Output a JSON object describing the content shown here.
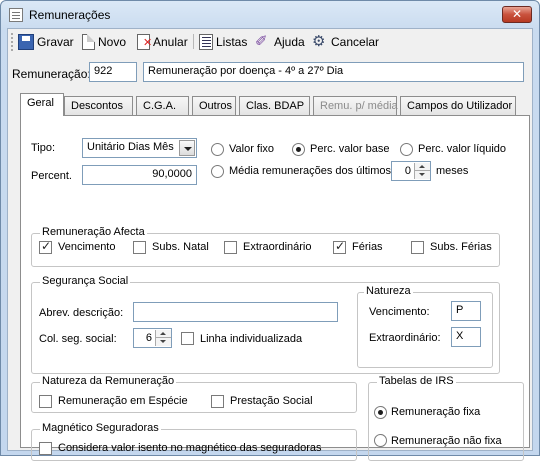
{
  "window": {
    "title": "Remunerações"
  },
  "toolbar": {
    "save": "Gravar",
    "new": "Novo",
    "cancel_record": "Anular",
    "lists": "Listas",
    "help": "Ajuda",
    "cancel": "Cancelar"
  },
  "header": {
    "remuneracao_label": "Remuneração:",
    "code": "922",
    "description": "Remuneração por doença - 4º a 27º Dia"
  },
  "tabs": [
    "Geral",
    "Descontos",
    "C.G.A.",
    "Outros",
    "Clas. BDAP",
    "Remu. p/ média",
    "Campos do Utilizador"
  ],
  "geral": {
    "tipo_label": "Tipo:",
    "tipo_value": "Unitário Dias Mês",
    "percent_label": "Percent.",
    "percent_value": "90,0000",
    "radio_valor_fixo": "Valor fixo",
    "radio_perc_base": "Perc. valor base",
    "radio_perc_liquido": "Perc. valor líquido",
    "radio_media": "Média remunerações dos últimos",
    "media_months": "0",
    "meses_label": "meses"
  },
  "remuneracao_afecta": {
    "title": "Remuneração Afecta",
    "items": [
      {
        "label": "Vencimento",
        "checked": true
      },
      {
        "label": "Subs. Natal",
        "checked": false
      },
      {
        "label": "Extraordinário",
        "checked": false
      },
      {
        "label": "Férias",
        "checked": true
      },
      {
        "label": "Subs. Férias",
        "checked": false
      }
    ]
  },
  "seguranca_social": {
    "title": "Segurança Social",
    "abrev_label": "Abrev. descrição:",
    "abrev_value": "",
    "col_label": "Col. seg. social:",
    "col_value": "6",
    "linha_label": "Linha individualizada",
    "natureza_title": "Natureza",
    "vencimento_label": "Vencimento:",
    "vencimento_value": "P",
    "extraordinario_label": "Extraordinário:",
    "extraordinario_value": "X"
  },
  "natureza_remuneracao": {
    "title": "Natureza da Remuneração",
    "especie": "Remuneração em Espécie",
    "prestacao": "Prestação Social"
  },
  "magnetico": {
    "title": "Magnético Seguradoras",
    "isento": "Considera valor isento no magnético das seguradoras"
  },
  "tabelas_irs": {
    "title": "Tabelas de IRS",
    "fixa": "Remuneração fixa",
    "nao_fixa": "Remuneração não fixa"
  }
}
